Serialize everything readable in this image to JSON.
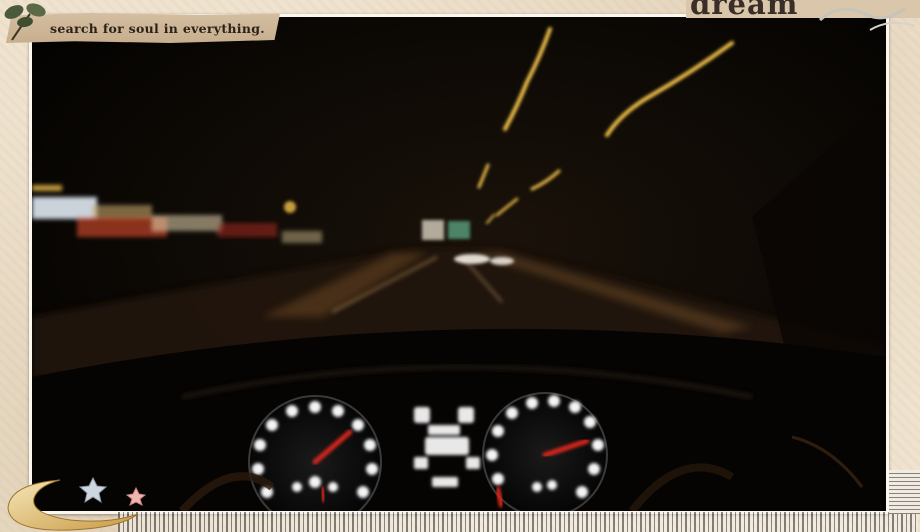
{
  "header": {
    "tagline": "search for soul in everything."
  },
  "corner_tape": {
    "word": "dream"
  },
  "photo": {
    "icon": "night-highway-dashboard-photo"
  },
  "decorations": {
    "moon_icon": "crescent-moon-icon",
    "star_icons": [
      "silver-star-icon",
      "pink-star-icon"
    ],
    "leaf_icon": "leaf-sprig-icon"
  },
  "colors": {
    "paper": "#efe3cf",
    "light_trail": "#f3c24a",
    "gauge_needle": "#d8261d"
  }
}
